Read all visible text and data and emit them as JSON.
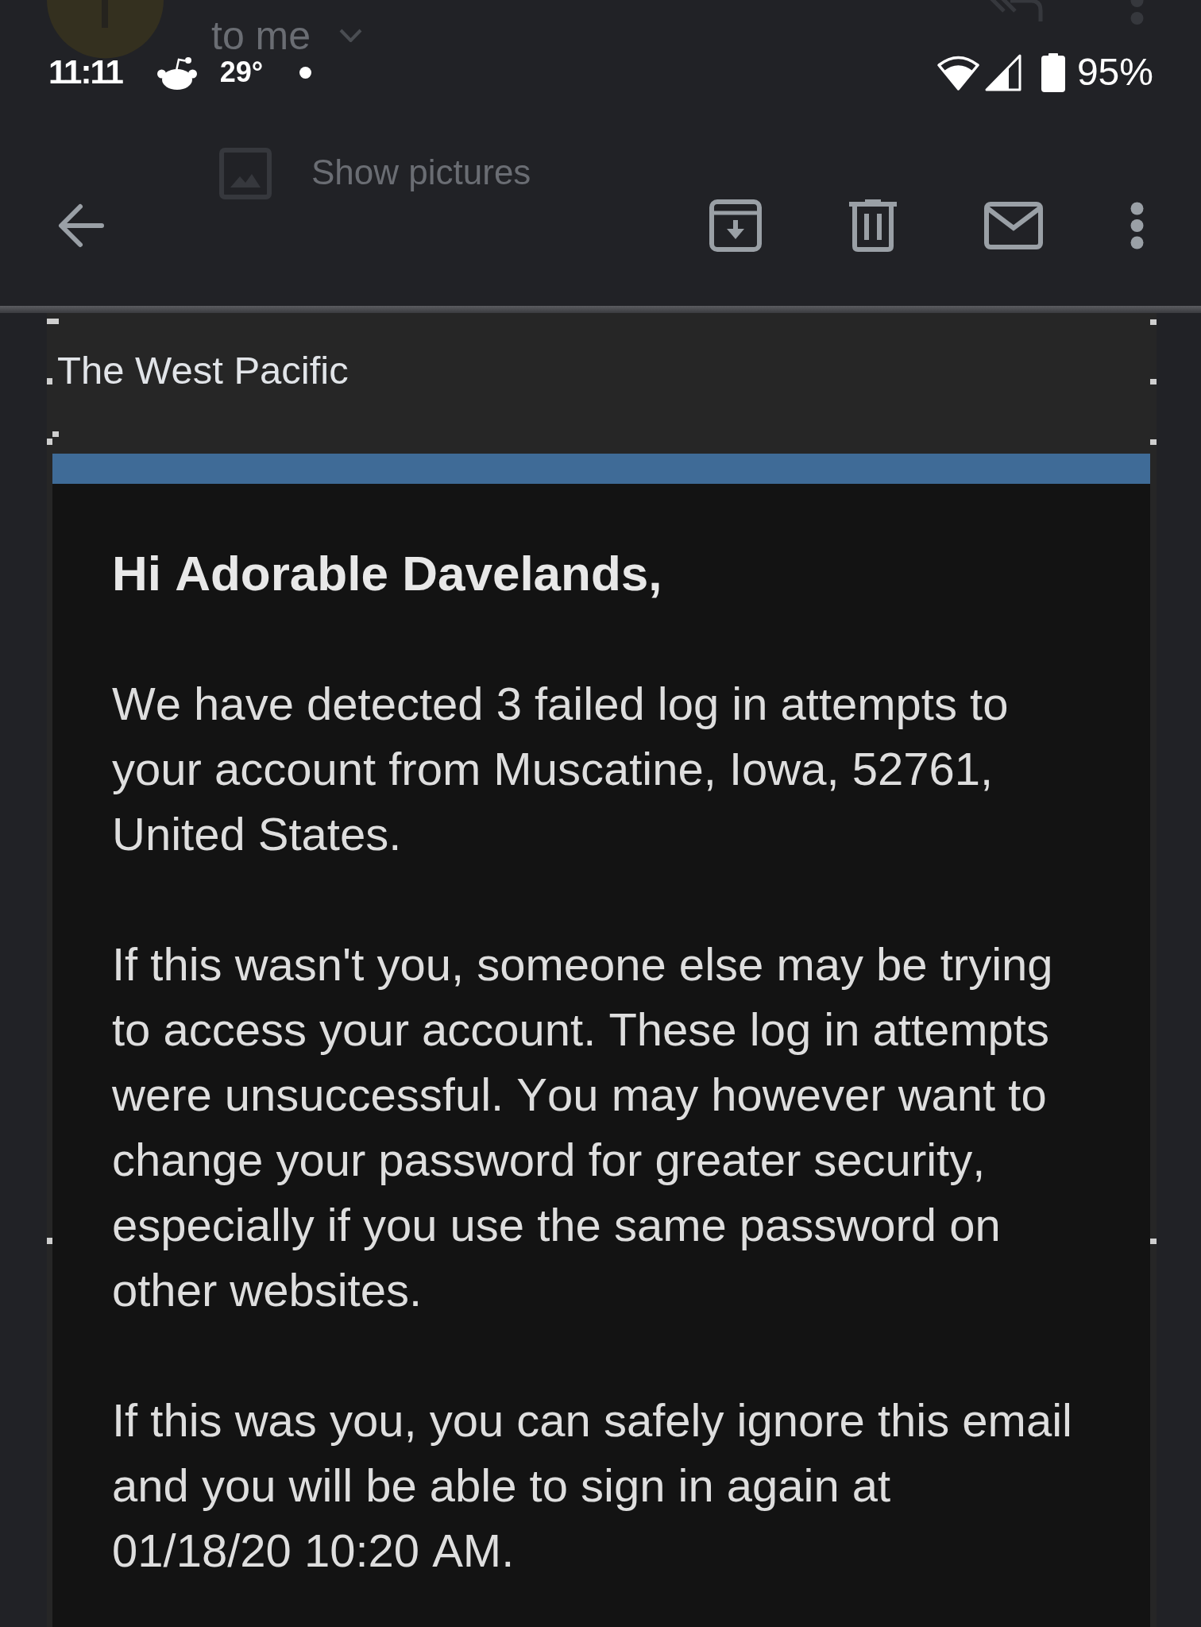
{
  "status_bar": {
    "time": "11:11",
    "temperature": "29°",
    "battery": "95%"
  },
  "message_header": {
    "recipient": "to me",
    "show_pictures": "Show pictures"
  },
  "email": {
    "sender_banner": "The West Pacific",
    "greeting": "Hi Adorable Davelands,",
    "paragraphs": [
      "We have detected 3 failed log in attempts to your account from Muscatine, Iowa, 52761, United States.",
      "If this wasn't you, someone else may be trying to access your account. These log in attempts were unsuccessful. You may however want to change your password for greater security, especially if you use the same password on other websites.",
      "If this was you, you can safely ignore this email and you will be able to sign in again at 01/18/20 10:20 AM."
    ]
  }
}
